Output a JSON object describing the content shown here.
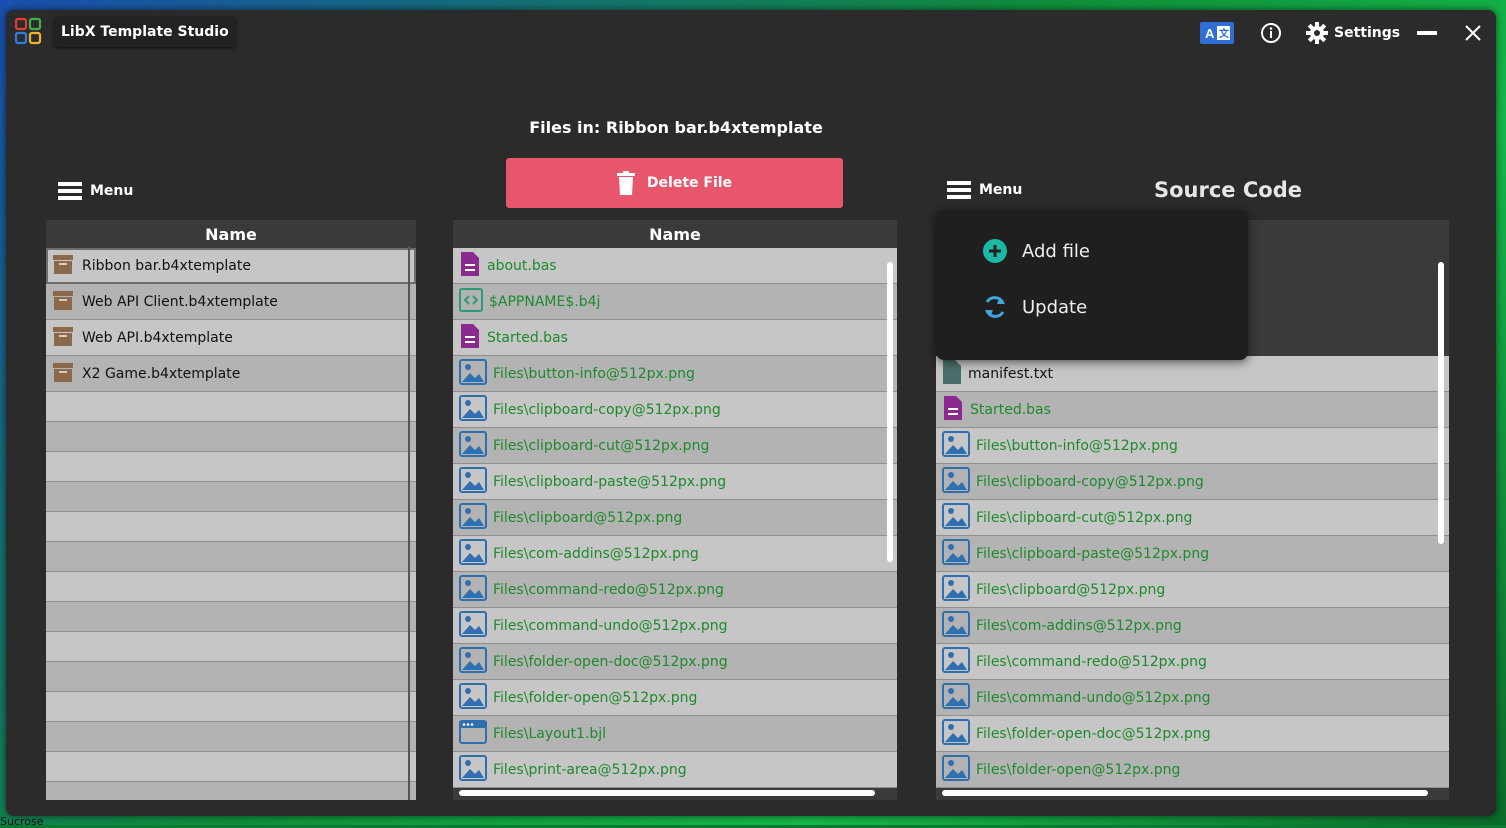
{
  "app": {
    "title": "LibX Template Studio"
  },
  "titlebar": {
    "lang_icon": "translate-icon",
    "settings_label": "Settings"
  },
  "files_title": "Files in: Ribbon bar.b4xtemplate",
  "delete_button": {
    "label": "Delete File",
    "color": "#e8566b"
  },
  "menu_left": {
    "label": "Menu"
  },
  "menu_right": {
    "label": "Menu"
  },
  "source_title": "Source Code",
  "left_panel": {
    "header": "Name",
    "items": [
      "Ribbon bar.b4xtemplate",
      "Web API Client.b4xtemplate",
      "Web API.b4xtemplate",
      "X2 Game.b4xtemplate"
    ]
  },
  "middle_panel": {
    "header": "Name",
    "items": [
      {
        "name": "about.bas",
        "icon": "doc"
      },
      {
        "name": "$APPNAME$.b4j",
        "icon": "code"
      },
      {
        "name": "Started.bas",
        "icon": "doc"
      },
      {
        "name": "Files\\button-info@512px.png",
        "icon": "image"
      },
      {
        "name": "Files\\clipboard-copy@512px.png",
        "icon": "image"
      },
      {
        "name": "Files\\clipboard-cut@512px.png",
        "icon": "image"
      },
      {
        "name": "Files\\clipboard-paste@512px.png",
        "icon": "image"
      },
      {
        "name": "Files\\clipboard@512px.png",
        "icon": "image"
      },
      {
        "name": "Files\\com-addins@512px.png",
        "icon": "image"
      },
      {
        "name": "Files\\command-redo@512px.png",
        "icon": "image"
      },
      {
        "name": "Files\\command-undo@512px.png",
        "icon": "image"
      },
      {
        "name": "Files\\folder-open-doc@512px.png",
        "icon": "image"
      },
      {
        "name": "Files\\folder-open@512px.png",
        "icon": "image"
      },
      {
        "name": "Files\\Layout1.bjl",
        "icon": "layout"
      },
      {
        "name": "Files\\print-area@512px.png",
        "icon": "image"
      }
    ]
  },
  "right_panel": {
    "items": [
      {
        "name": "manifest.txt",
        "icon": "txt"
      },
      {
        "name": "Started.bas",
        "icon": "doc"
      },
      {
        "name": "Files\\button-info@512px.png",
        "icon": "image"
      },
      {
        "name": "Files\\clipboard-copy@512px.png",
        "icon": "image"
      },
      {
        "name": "Files\\clipboard-cut@512px.png",
        "icon": "image"
      },
      {
        "name": "Files\\clipboard-paste@512px.png",
        "icon": "image"
      },
      {
        "name": "Files\\clipboard@512px.png",
        "icon": "image"
      },
      {
        "name": "Files\\com-addins@512px.png",
        "icon": "image"
      },
      {
        "name": "Files\\command-redo@512px.png",
        "icon": "image"
      },
      {
        "name": "Files\\command-undo@512px.png",
        "icon": "image"
      },
      {
        "name": "Files\\folder-open-doc@512px.png",
        "icon": "image"
      },
      {
        "name": "Files\\folder-open@512px.png",
        "icon": "image"
      }
    ]
  },
  "dropdown": {
    "add_file": "Add file",
    "update": "Update"
  },
  "desktop_label": "Sucrose",
  "colors": {
    "file_text": "#1d8a2c",
    "image_icon": "#2f6fb0",
    "doc_icon": "#8a2a8f",
    "archive_icon": "#8a6a4a",
    "accent_teal": "#1bb8a5"
  }
}
